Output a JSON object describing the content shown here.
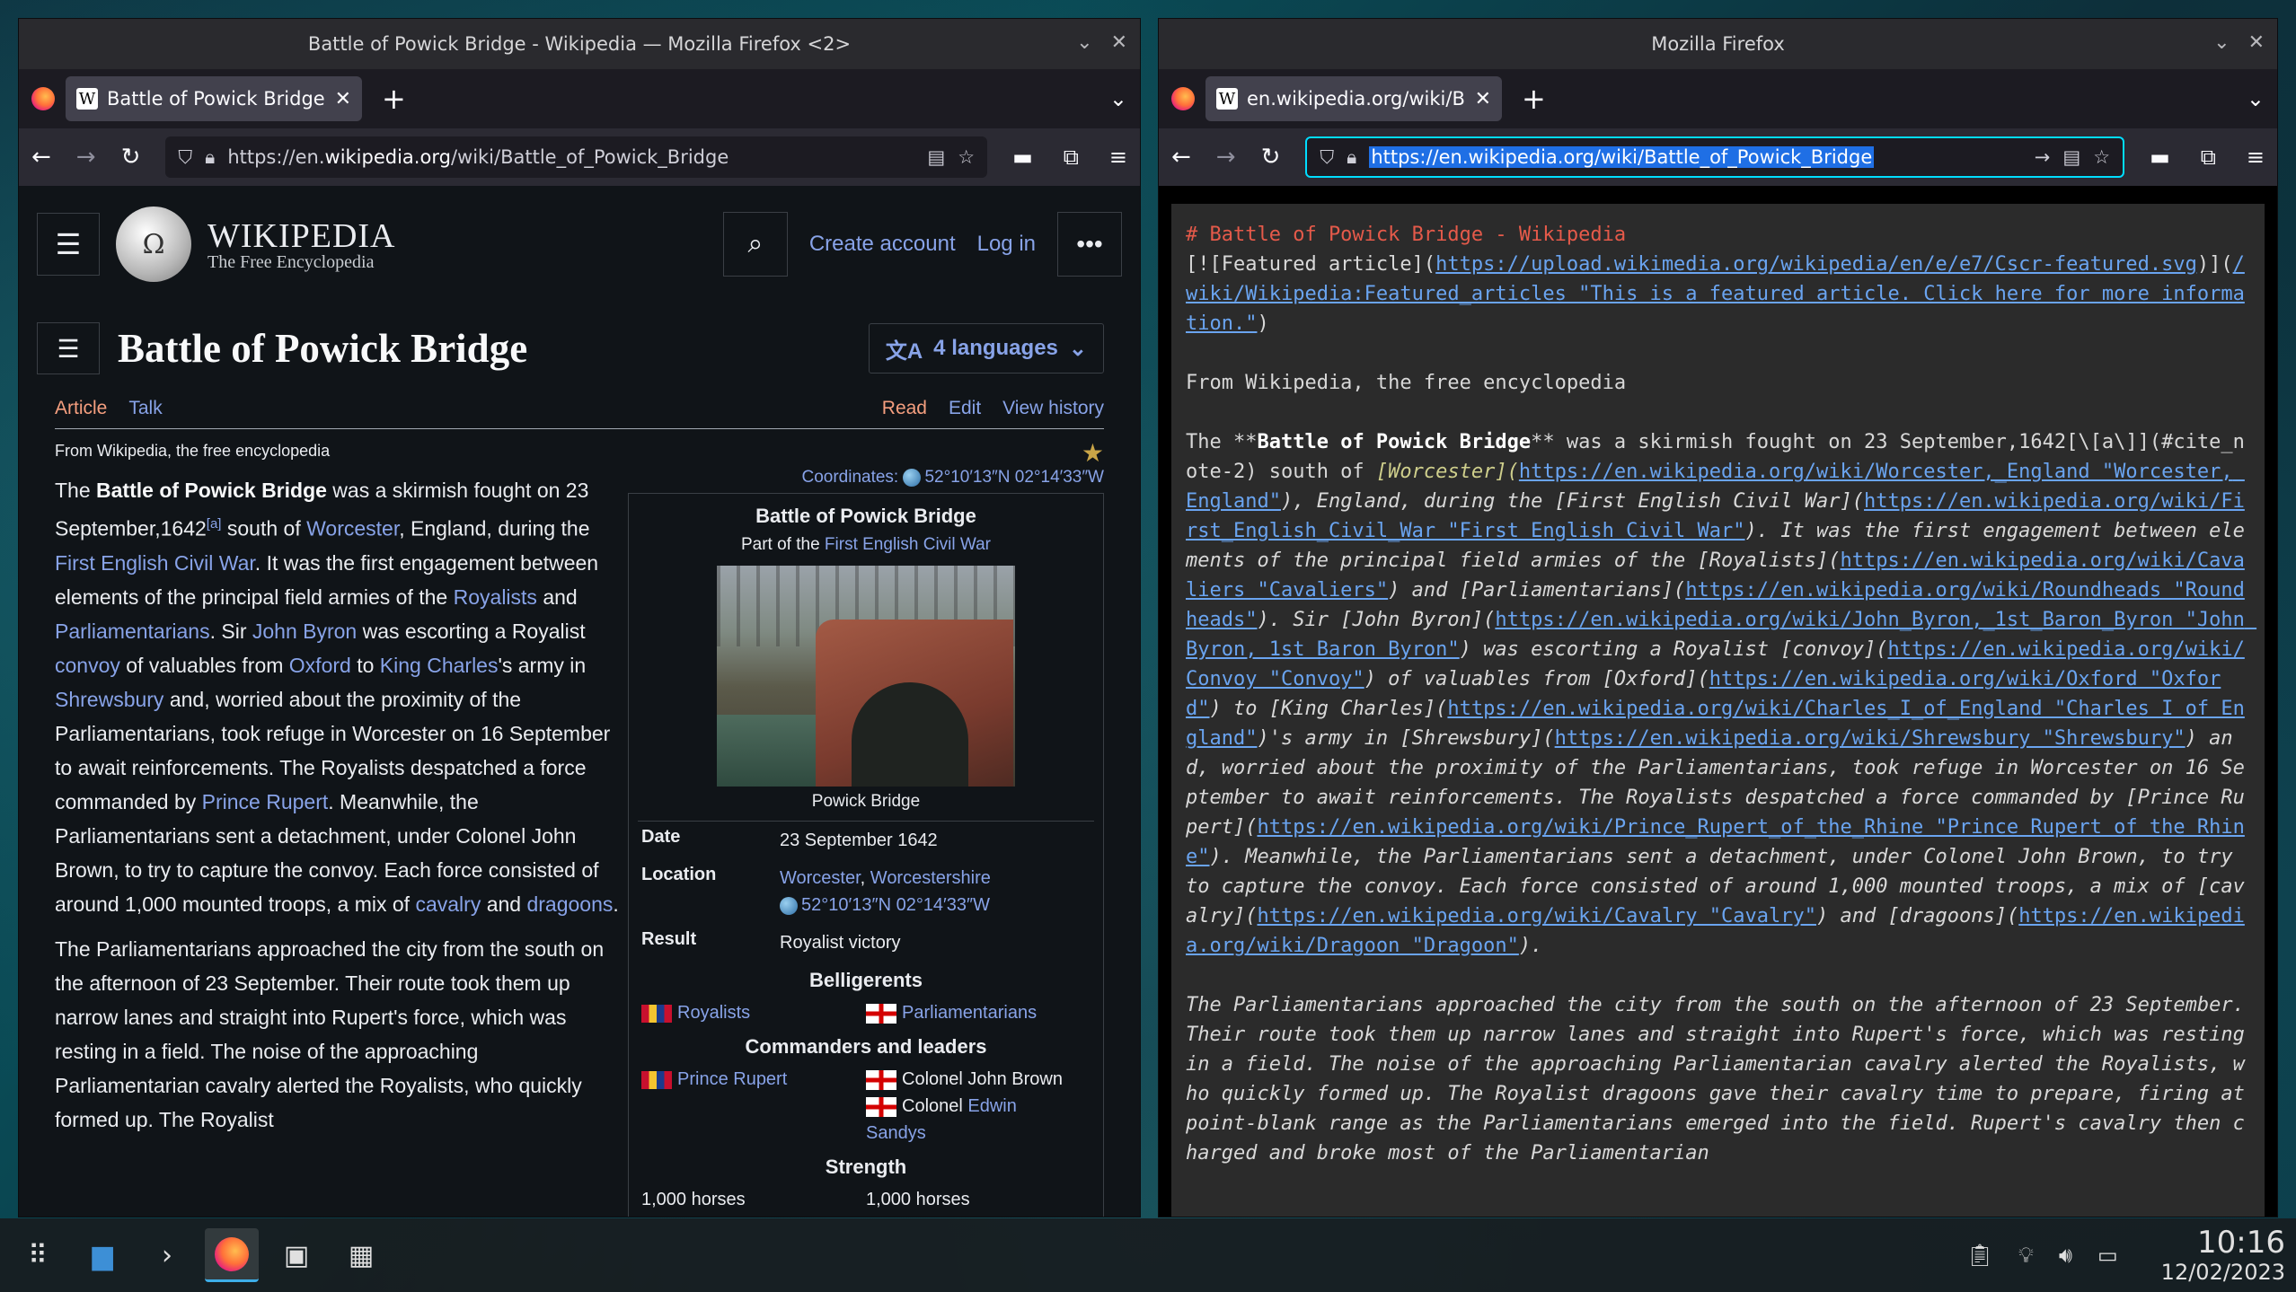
{
  "left_window": {
    "title": "Battle of Powick Bridge - Wikipedia — Mozilla Firefox <2>",
    "tab_label": "Battle of Powick Bridge - W",
    "url_prefix": "https://en.",
    "url_domain": "wikipedia.org",
    "url_path": "/wiki/Battle_of_Powick_Bridge"
  },
  "right_window": {
    "title": "Mozilla Firefox",
    "tab_label": "en.wikipedia.org/wiki/Batt",
    "url": "https://en.wikipedia.org/wiki/Battle_of_Powick_Bridge"
  },
  "wiki": {
    "wordmark": "WIKIPEDIA",
    "tagline": "The Free Encyclopedia",
    "create_account": "Create account",
    "log_in": "Log in",
    "page_title": "Battle of Powick Bridge",
    "languages": "4 languages",
    "tabs": {
      "article": "Article",
      "talk": "Talk",
      "read": "Read",
      "edit": "Edit",
      "history": "View history"
    },
    "from": "From Wikipedia, the free encyclopedia",
    "coords_label": "Coordinates:",
    "coords_value": "52°10′13″N 02°14′33″W",
    "infobox": {
      "title": "Battle of Powick Bridge",
      "sub_prefix": "Part of the",
      "sub_link": "First English Civil War",
      "caption": "Powick Bridge",
      "date_k": "Date",
      "date_v": "23 September 1642",
      "location_k": "Location",
      "location_v1": "Worcester",
      "location_v2": "Worcestershire",
      "location_coords": "52°10′13″N 02°14′33″W",
      "result_k": "Result",
      "result_v": "Royalist victory",
      "belligerents": "Belligerents",
      "royalists": "Royalists",
      "parliamentarians": "Parliamentarians",
      "commanders": "Commanders and leaders",
      "prince_rupert": "Prince Rupert",
      "colonel_brown": "Colonel John Brown",
      "colonel_prefix": "Colonel",
      "edwin": "Edwin",
      "sandys": "Sandys",
      "strength": "Strength",
      "strength_left": "1,000 horses",
      "strength_right": "1,000 horses"
    },
    "p1": {
      "t1": "The ",
      "bold": "Battle of Powick Bridge",
      "t2": " was a skirmish fought on 23 September,1642",
      "sup": "[a]",
      "t3": " south of ",
      "l1": "Worcester",
      "t4": ", England, during the ",
      "l2": "First English Civil War",
      "t5": ". It was the first engagement between elements of the principal field armies of the ",
      "l3": "Royalists",
      "t6": " and ",
      "l4": "Parliamentarians",
      "t7": ". Sir ",
      "l5": "John Byron",
      "t8": " was escorting a Royalist ",
      "l6": "convoy",
      "t9": " of valuables from ",
      "l7": "Oxford",
      "t10": " to ",
      "l8": "King Charles",
      "t11": "'s army in ",
      "l9": "Shrewsbury",
      "t12": " and, worried about the proximity of the Parliamentarians, took refuge in Worcester on 16 September to await reinforcements. The Royalists despatched a force commanded by ",
      "l10": "Prince Rupert",
      "t13": ". Meanwhile, the Parliamentarians sent a detachment, under Colonel John Brown, to try to capture the convoy. Each force consisted of around 1,000 mounted troops, a mix of ",
      "l11": "cavalry",
      "t14": " and ",
      "l12": "dragoons",
      "t15": "."
    },
    "p2": "The Parliamentarians approached the city from the south on the afternoon of 23 September. Their route took them up narrow lanes and straight into Rupert's force, which was resting in a field. The noise of the approaching Parliamentarian cavalry alerted the Royalists, who quickly formed up. The Royalist"
  },
  "markdown": {
    "heading": "# Battle of Powick Bridge - Wikipedia",
    "featured_a": "[![Featured article](",
    "featured_link1": "https://upload.wikimedia.org/wikipedia/en/e/e7/Cscr-featured.svg",
    "featured_b": ")](",
    "featured_link2": "/wiki/Wikipedia:Featured_articles \"This is a featured article. Click here for more information.\"",
    "featured_c": ")",
    "from": "From Wikipedia, the free encyclopedia",
    "p1_a": "The **",
    "p1_bold": "Battle of Powick Bridge",
    "p1_b": "** was a skirmish fought on 23 September,1642[\\[a\\]](#cite_note-2) south of ",
    "p1_rest_1": "[Worcester](",
    "p1_link_1": "https://en.wikipedia.org/wiki/Worcester,_England \"Worcester, England\"",
    "p1_rest_2": "), England, during the [First English Civil War](",
    "p1_link_2": "https://en.wikipedia.org/wiki/First_English_Civil_War \"First English Civil War\"",
    "p1_rest_3": "). It was the first engagement between elements of the principal field armies of the [Royalists](",
    "p1_link_3": "https://en.wikipedia.org/wiki/Cavaliers \"Cavaliers\"",
    "p1_rest_4": ") and [Parliamentarians](",
    "p1_link_4": "https://en.wikipedia.org/wiki/Roundheads \"Roundheads\"",
    "p1_rest_5": "). Sir [John Byron](",
    "p1_link_5": "https://en.wikipedia.org/wiki/John_Byron,_1st_Baron_Byron \"John Byron, 1st Baron Byron\"",
    "p1_rest_6": ") was escorting a Royalist [convoy](",
    "p1_link_6": "https://en.wikipedia.org/wiki/Convoy \"Convoy\"",
    "p1_rest_7": ") of valuables from [Oxford](",
    "p1_link_7": "https://en.wikipedia.org/wiki/Oxford \"Oxford\"",
    "p1_rest_8": ") to [King Charles](",
    "p1_link_8": "https://en.wikipedia.org/wiki/Charles_I_of_England \"Charles I of England\"",
    "p1_rest_9": ")'s army in [Shrewsbury](",
    "p1_link_9": "https://en.wikipedia.org/wiki/Shrewsbury \"Shrewsbury\"",
    "p1_rest_10": ") and, worried about the proximity of the Parliamentarians, took refuge in Worcester on 16 September to await reinforcements. The Royalists despatched a force commanded by [Prince Rupert](",
    "p1_link_10": "https://en.wikipedia.org/wiki/Prince_Rupert_of_the_Rhine \"Prince Rupert of the Rhine\"",
    "p1_rest_11": "). Meanwhile, the Parliamentarians sent a detachment, under Colonel John Brown, to try to capture the convoy. Each force consisted of around 1,000 mounted troops, a mix of [cavalry](",
    "p1_link_11": "https://en.wikipedia.org/wiki/Cavalry \"Cavalry\"",
    "p1_rest_12": ") and [dragoons](",
    "p1_link_12": "https://en.wikipedia.org/wiki/Dragoon \"Dragoon\"",
    "p1_rest_13": ").",
    "p2": "The Parliamentarians approached the city from the south on the afternoon of 23 September. Their route took them up narrow lanes and straight into Rupert's force, which was resting in a field. The noise of the approaching Parliamentarian cavalry alerted the Royalists, who quickly formed up. The Royalist dragoons gave their cavalry time to prepare, firing at point-blank range as the Parliamentarians emerged into the field. Rupert's cavalry then charged and broke most of the Parliamentarian"
  },
  "taskbar": {
    "time": "10:16",
    "date": "12/02/2023"
  },
  "icons": {
    "back": "←",
    "forward": "→",
    "reload": "↻",
    "menu": "≡",
    "close": "✕",
    "chevron": "⌄"
  },
  "colors": {
    "link": "#88a3e8",
    "active_tab": "#f59f7f",
    "md_heading": "#e55a4a",
    "md_link": "#6aa4f0"
  }
}
